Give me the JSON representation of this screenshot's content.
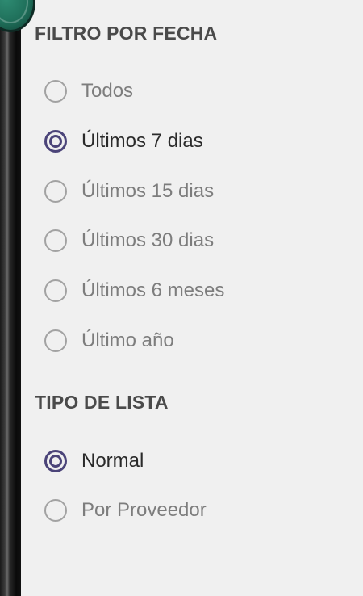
{
  "filter_by_date": {
    "title": "FILTRO POR FECHA",
    "options": [
      {
        "label": "Todos",
        "selected": false
      },
      {
        "label": "Últimos 7 dias",
        "selected": true
      },
      {
        "label": "Últimos 15 dias",
        "selected": false
      },
      {
        "label": "Últimos 30 dias",
        "selected": false
      },
      {
        "label": "Últimos 6 meses",
        "selected": false
      },
      {
        "label": "Último año",
        "selected": false
      }
    ]
  },
  "list_type": {
    "title": "TIPO DE LISTA",
    "options": [
      {
        "label": "Normal",
        "selected": true
      },
      {
        "label": "Por Proveedor",
        "selected": false
      }
    ]
  },
  "colors": {
    "background": "#f0f0f0",
    "accent": "#4b4479",
    "radio_unchecked": "#a2a2a2",
    "title_text": "#4a4a4a"
  }
}
